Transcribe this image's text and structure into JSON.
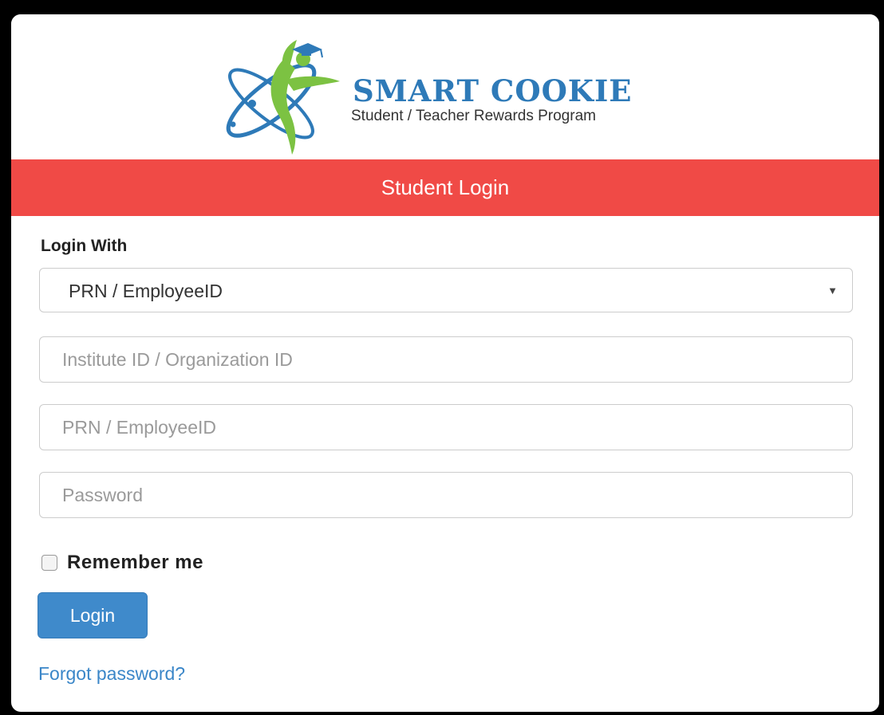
{
  "brand": {
    "name": "SMART COOKIE",
    "tagline": "Student / Teacher Rewards Program"
  },
  "banner": {
    "title": "Student Login"
  },
  "form": {
    "login_with_label": "Login With",
    "login_with_selected": "PRN / EmployeeID",
    "institute_placeholder": "Institute ID / Organization ID",
    "prn_placeholder": "PRN / EmployeeID",
    "password_placeholder": "Password",
    "remember_label": "Remember me",
    "remember_checked": false,
    "login_button": "Login",
    "forgot_link": "Forgot password?"
  },
  "icons": {
    "logo": "smart-cookie-logo-icon",
    "select_caret": "caret-down-icon",
    "remember_checkbox": "checkbox-icon"
  },
  "colors": {
    "banner": "#f04a46",
    "brand_blue": "#2e7ab8",
    "logo_green": "#7cc242",
    "button": "#3f8acb",
    "link": "#3a86c8"
  }
}
